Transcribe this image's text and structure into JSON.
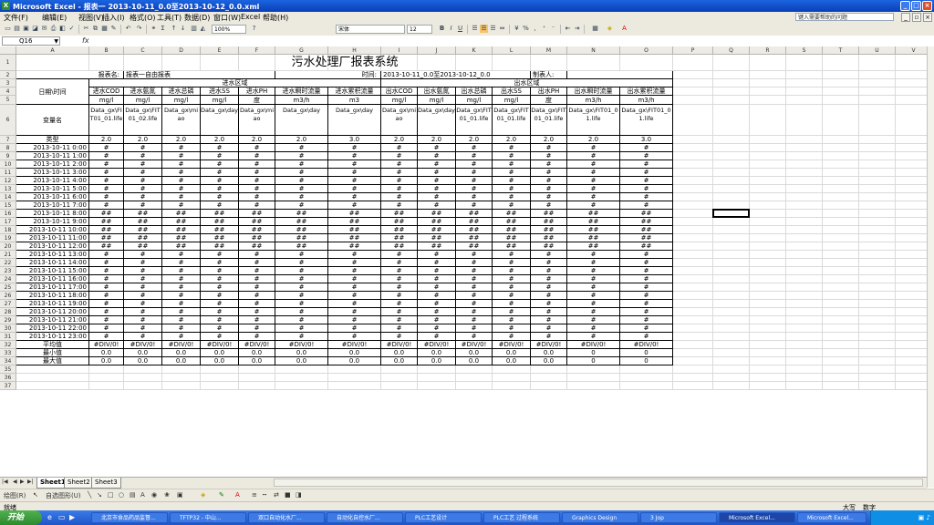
{
  "window": {
    "title": "Microsoft Excel - 报表一 2013-10-11_0.0至2013-10-12_0.0.xml",
    "buttons": [
      "_",
      "□",
      "×"
    ]
  },
  "menu": {
    "items": [
      "文件(F)",
      "编辑(E)",
      "视图(V)",
      "插入(I)",
      "格式(O)",
      "工具(T)",
      "数据(D)",
      "窗口(W)",
      "Excel",
      "帮助(H)"
    ],
    "help_placeholder": "键入需要帮助的问题"
  },
  "toolbar": {
    "zoom": "100%",
    "font": "宋体",
    "size": "12"
  },
  "formula_bar": {
    "name_box": "Q16",
    "fx": "fx",
    "value": ""
  },
  "grid": {
    "columns": [
      "A",
      "B",
      "C",
      "D",
      "E",
      "F",
      "G",
      "H",
      "I",
      "J",
      "K",
      "L",
      "M",
      "N",
      "O",
      "P",
      "Q",
      "R",
      "S",
      "T",
      "U",
      "V"
    ],
    "row_numbers": [
      "1",
      "2",
      "3",
      "4",
      "5",
      "6",
      "7",
      "8",
      "9",
      "10",
      "11",
      "12",
      "13",
      "14",
      "15",
      "16",
      "17",
      "18",
      "19",
      "20",
      "21",
      "22",
      "23",
      "24",
      "25",
      "26",
      "27",
      "28",
      "29",
      "30",
      "31",
      "32",
      "33",
      "34",
      "35",
      "36",
      "37"
    ]
  },
  "report": {
    "title": "污水处理厂报表系统",
    "name_label": "报表名:",
    "name_value": "报表一自由报表",
    "time_label": "时间:",
    "time_value": "2013-10-11_0.0至2013-10-12_0.0",
    "reporter_label": "制表人:",
    "date_time_label": "日期\\时间",
    "inflow_group": "进水区域",
    "outflow_group": "出水区域",
    "metrics": [
      "进水COD",
      "进水氨氮",
      "进水总磷",
      "进水SS",
      "进水PH",
      "进水瞬时流量",
      "进水累积流量",
      "出水COD",
      "出水氨氮",
      "出水总磷",
      "出水SS",
      "出水PH",
      "出水瞬时流量",
      "出水累积流量"
    ],
    "units": [
      "mg/l",
      "mg/l",
      "mg/l",
      "mg/l",
      "度",
      "m3/h",
      "m3",
      "mg/l",
      "mg/l",
      "mg/l",
      "mg/l",
      "度",
      "m3/h",
      "m3/h"
    ],
    "variable_label": "变量名",
    "variables": [
      "Data_gx\\FIT01_01.life",
      "Data_gx\\FIT01_02.life",
      "Data_gx\\miao",
      "Data_gx\\day",
      "Data_gx\\miao",
      "Data_gx\\day",
      "Data_gx\\day",
      "Data_gx\\miao",
      "Data_gx\\day",
      "Data_gx\\FIT01_01.life",
      "Data_gx\\FIT01_01.life",
      "Data_gx\\FIT01_01.life",
      "Data_gx\\FIT01_01.life",
      "Data_gx\\FIT01_01.life"
    ],
    "type_label": "类型",
    "types": [
      "2.0",
      "2.0",
      "2.0",
      "2.0",
      "2.0",
      "2.0",
      "3.0",
      "2.0",
      "2.0",
      "2.0",
      "2.0",
      "2.0",
      "2.0",
      "3.0"
    ],
    "times": [
      "2013-10-11 0:00",
      "2013-10-11 1:00",
      "2013-10-11 2:00",
      "2013-10-11 3:00",
      "2013-10-11 4:00",
      "2013-10-11 5:00",
      "2013-10-11 6:00",
      "2013-10-11 7:00",
      "2013-10-11 8:00",
      "2013-10-11 9:00",
      "2013-10-11 10:00",
      "2013-10-11 11:00",
      "2013-10-11 12:00",
      "2013-10-11 13:00",
      "2013-10-11 14:00",
      "2013-10-11 15:00",
      "2013-10-11 16:00",
      "2013-10-11 17:00",
      "2013-10-11 18:00",
      "2013-10-11 19:00",
      "2013-10-11 20:00",
      "2013-10-11 21:00",
      "2013-10-11 22:00",
      "2013-10-11 23:00"
    ],
    "hash_rows": [
      "#",
      "#",
      "#",
      "#",
      "#",
      "#",
      "#",
      "#",
      "##",
      "##",
      "##",
      "##",
      "##",
      "#",
      "#",
      "#",
      "#",
      "#",
      "#",
      "#",
      "#",
      "#",
      "#",
      "#"
    ],
    "avg_label": "平均值",
    "avg_values": [
      "#DIV/0!",
      "#DIV/0!",
      "#DIV/0!",
      "#DIV/0!",
      "#DIV/0!",
      "#DIV/0!",
      "#DIV/0!",
      "#DIV/0!",
      "#DIV/0!",
      "#DIV/0!",
      "#DIV/0!",
      "#DIV/0!",
      "#DIV/0!",
      "#DIV/0!"
    ],
    "min_label": "最小值",
    "min_values": [
      "0.0",
      "0.0",
      "0.0",
      "0.0",
      "0.0",
      "0.0",
      "0.0",
      "0.0",
      "0.0",
      "0.0",
      "0.0",
      "0.0",
      "0",
      "0"
    ],
    "max_label": "最大值",
    "max_values": [
      "0.0",
      "0.0",
      "0.0",
      "0.0",
      "0.0",
      "0.0",
      "0.0",
      "0.0",
      "0.0",
      "0.0",
      "0.0",
      "0.0",
      "0",
      "0"
    ]
  },
  "sheet_tabs": [
    "Sheet1",
    "Sheet2",
    "Sheet3"
  ],
  "drawing_toolbar": {
    "draw_label": "绘图(R)",
    "autoshape_label": "自选图形(U)"
  },
  "status": {
    "left": "就绪",
    "right1": "大写",
    "right2": "数字"
  },
  "taskbar": {
    "start": "开始",
    "tasks": [
      "北京市食品药品监督...",
      "TFTP32 - 中山...",
      "双口自动化水厂...",
      "自动化自控水厂...",
      "PLC工艺设计",
      "PLC工艺 过程系统",
      "Graphics Design",
      "3 Jop",
      "Microsoft Excel...",
      "Microsoft Excel..."
    ],
    "clock": ""
  }
}
